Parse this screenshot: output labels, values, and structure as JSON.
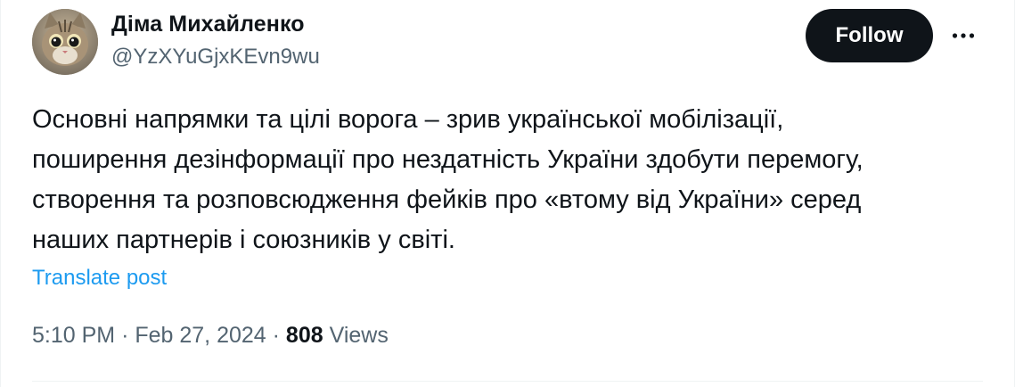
{
  "author": {
    "display_name": "Діма Михайленко",
    "handle": "@YzXYuGjxKEvn9wu",
    "avatar_icon": "cat-avatar"
  },
  "actions": {
    "follow_label": "Follow",
    "more_icon": "more-horizontal-icon"
  },
  "post": {
    "text_lines": [
      "Основні напрямки та цілі ворога – зрив української мобілізації,",
      "поширення дезінформації про нездатність України здобути перемогу,",
      "створення та розповсюдження фейків про «втому від України» серед",
      "наших партнерів і союзників у світі."
    ],
    "translate_label": "Translate post"
  },
  "meta": {
    "time": "5:10 PM",
    "separator": "·",
    "date": "Feb 27, 2024",
    "views_count": "808",
    "views_label": "Views"
  },
  "colors": {
    "text": "#0f1419",
    "secondary": "#536471",
    "link": "#1d9bf0",
    "button_bg": "#0f1419"
  }
}
